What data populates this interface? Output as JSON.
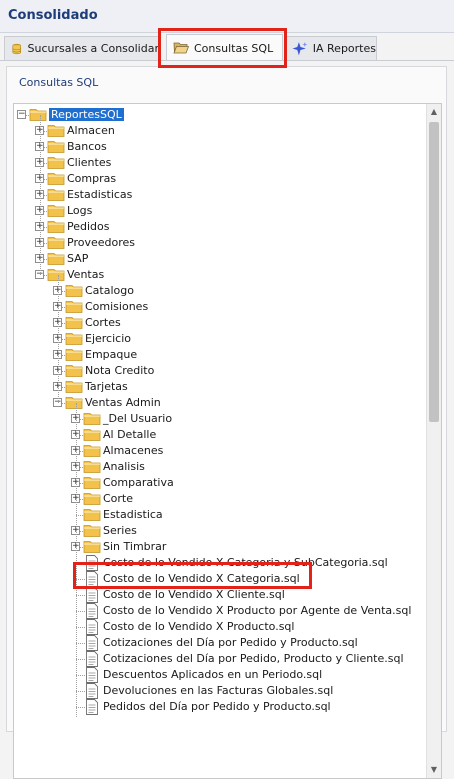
{
  "window": {
    "title": "Consolidado"
  },
  "tabs": [
    {
      "label": "Sucursales a Consolidar",
      "icon": "database-icon",
      "active": false
    },
    {
      "label": "Consultas SQL",
      "icon": "folder-open-icon",
      "active": true
    },
    {
      "label": "IA Reportes",
      "icon": "sparkle-icon",
      "active": false
    }
  ],
  "panel": {
    "title": "Consultas SQL"
  },
  "tree": {
    "root": "ReportesSQL",
    "level1": [
      "Almacen",
      "Bancos",
      "Clientes",
      "Compras",
      "Estadisticas",
      "Logs",
      "Pedidos",
      "Proveedores",
      "SAP",
      "Ventas"
    ],
    "ventas": [
      "Catalogo",
      "Comisiones",
      "Cortes",
      "Ejercicio",
      "Empaque",
      "Nota Credito",
      "Tarjetas",
      "Ventas Admin"
    ],
    "ventas_admin_folders": [
      "_Del Usuario",
      "Al Detalle",
      "Almacenes",
      "Analisis",
      "Comparativa",
      "Corte",
      "Estadistica",
      "Series",
      "Sin Timbrar"
    ],
    "files": [
      "Costo de lo Vendido X Categoria y SubCategoria.sql",
      "Costo de lo Vendido X Categoria.sql",
      "Costo de lo Vendido X Cliente.sql",
      "Costo de lo Vendido X Producto por Agente de Venta.sql",
      "Costo de lo Vendido X Producto.sql",
      "Cotizaciones del Día por Pedido y Producto.sql",
      "Cotizaciones del Día por Pedido, Producto y Cliente.sql",
      "Descuentos Aplicados en un Periodo.sql",
      "Devoluciones en las Facturas Globales.sql",
      "Pedidos del Día por Pedido y Producto.sql"
    ]
  },
  "colors": {
    "highlight": "#e2231a",
    "selection": "#1f6fd1",
    "folder": "#f3c24a"
  }
}
